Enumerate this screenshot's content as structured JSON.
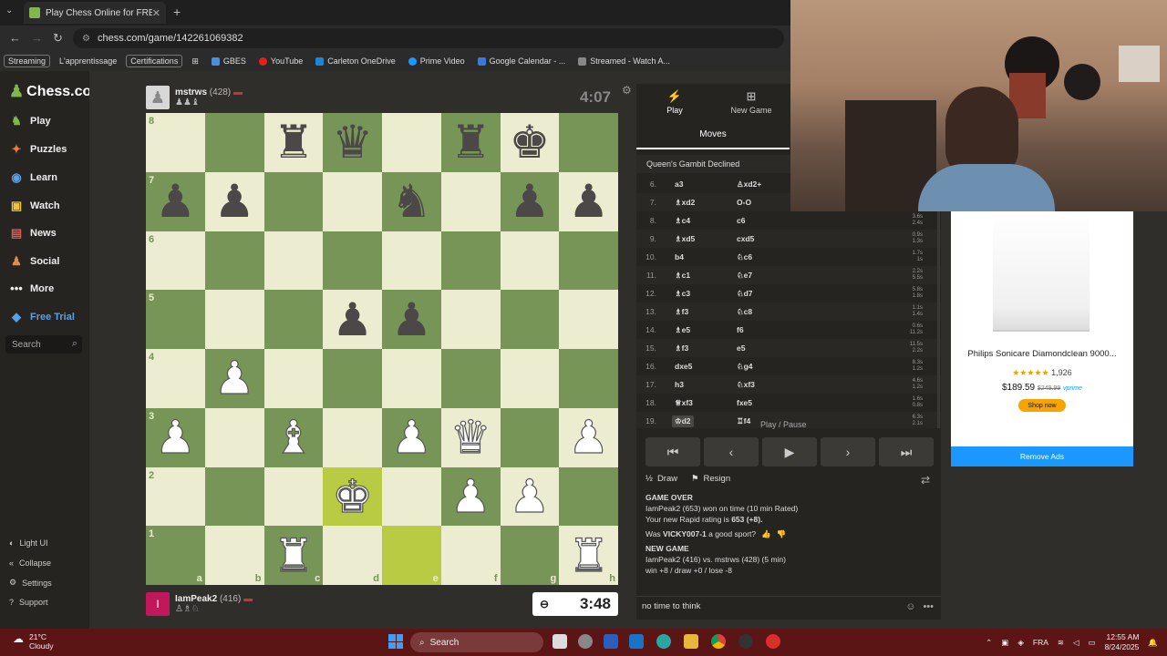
{
  "browser": {
    "tab_title": "Play Chess Online for FREE - 2 P",
    "url_site": "chess.com",
    "url_path": "chess.com/game/142261069382",
    "bookmarks": [
      "Streaming",
      "L'apprentissage",
      "Certifications",
      "GBES",
      "YouTube",
      "Carleton OneDrive",
      "Prime Video",
      "Google Calendar - ...",
      "Streamed - Watch A..."
    ]
  },
  "sidebar": {
    "logo": "Chess.com",
    "badge": "1",
    "items": [
      "Play",
      "Puzzles",
      "Learn",
      "Watch",
      "News",
      "Social",
      "More",
      "Free Trial"
    ],
    "search_placeholder": "Search",
    "bottom": [
      "Light UI",
      "Collapse",
      "Settings",
      "Support"
    ]
  },
  "top_player": {
    "name": "mstrws",
    "rating": "(428)",
    "captures": "♟♟♝",
    "clock": "4:07"
  },
  "bottom_player": {
    "name": "IamPeak2",
    "rating": "(416)",
    "captures": "♙♗♘",
    "clock": "3:48"
  },
  "board": {
    "light_color": "#ebecd0",
    "dark_color": "#779556",
    "highlight_squares": [
      "d2",
      "e1"
    ],
    "ranks": [
      "8",
      "7",
      "6",
      "5",
      "4",
      "3",
      "2",
      "1"
    ],
    "files": [
      "a",
      "b",
      "c",
      "d",
      "e",
      "f",
      "g",
      "h"
    ],
    "position": [
      [
        "",
        "",
        "bR",
        "bQ",
        "",
        "bR",
        "bK",
        ""
      ],
      [
        "bP",
        "bP",
        "",
        "",
        "bN",
        "",
        "bP",
        "bP"
      ],
      [
        "",
        "",
        "",
        "",
        "",
        "",
        "",
        ""
      ],
      [
        "",
        "",
        "",
        "bP",
        "bP",
        "",
        "",
        ""
      ],
      [
        "",
        "wP",
        "",
        "",
        "",
        "",
        "",
        ""
      ],
      [
        "wP",
        "",
        "wB",
        "",
        "wP",
        "wQ",
        "",
        "wP"
      ],
      [
        "",
        "",
        "",
        "wK",
        "",
        "wP",
        "wP",
        ""
      ],
      [
        "",
        "",
        "wR",
        "",
        "",
        "",
        "",
        "wR"
      ]
    ]
  },
  "panel": {
    "tabs": [
      {
        "label": "Play",
        "icon": "bolt-icon"
      },
      {
        "label": "New Game",
        "icon": "plus-icon"
      }
    ],
    "moves_tab": "Moves",
    "opening": "Queen's Gambit Declined",
    "moves": [
      {
        "n": "6.",
        "w": "a3",
        "b": "♙xd2+",
        "tw": "",
        "tb": ""
      },
      {
        "n": "7.",
        "w": "♗xd2",
        "b": "O-O",
        "tw": "",
        "tb": ""
      },
      {
        "n": "8.",
        "w": "♗c4",
        "b": "c6",
        "tw": "3.6s",
        "tb": "2.4s"
      },
      {
        "n": "9.",
        "w": "♗xd5",
        "b": "cxd5",
        "tw": "0.9s",
        "tb": "1.3s"
      },
      {
        "n": "10.",
        "w": "b4",
        "b": "♘c6",
        "tw": "1.7s",
        "tb": "1s"
      },
      {
        "n": "11.",
        "w": "♗c1",
        "b": "♘e7",
        "tw": "2.2s",
        "tb": "5.5s"
      },
      {
        "n": "12.",
        "w": "♗c3",
        "b": "♘d7",
        "tw": "5.8s",
        "tb": "1.8s"
      },
      {
        "n": "13.",
        "w": "♗f3",
        "b": "♘c8",
        "tw": "1.1s",
        "tb": "1.4s"
      },
      {
        "n": "14.",
        "w": "♗e5",
        "b": "f6",
        "tw": "0.6s",
        "tb": "11.2s"
      },
      {
        "n": "15.",
        "w": "♗f3",
        "b": "e5",
        "tw": "11.5s",
        "tb": "2.2s"
      },
      {
        "n": "16.",
        "w": "dxe5",
        "b": "♘g4",
        "tw": "8.3s",
        "tb": "1.2s"
      },
      {
        "n": "17.",
        "w": "h3",
        "b": "♘xf3",
        "tw": "4.6s",
        "tb": "1.2s"
      },
      {
        "n": "18.",
        "w": "♕xf3",
        "b": "fxe5",
        "tw": "1.6s",
        "tb": "0.8s"
      },
      {
        "n": "19.",
        "w": "♔d2",
        "b": "♖f4",
        "tw": "6.3s",
        "tb": "2.1s"
      }
    ],
    "tooltip": "Play / Pause",
    "draw": "Draw",
    "resign": "Resign",
    "log": {
      "game_over": "GAME OVER",
      "result": "IamPeak2 (653) won on time (10 min Rated)",
      "rating_prefix": "Your new Rapid rating is ",
      "rating_value": "653 (+8).",
      "sport_prefix": "Was ",
      "sport_user": "VICKY007-1",
      "sport_suffix": " a good sport?",
      "new_game": "NEW GAME",
      "matchup": "IamPeak2 (416) vs. mstrws (428) (5 min)",
      "record": "win +8 / draw +0 / lose -8"
    },
    "chat_text": "no time to think"
  },
  "ad": {
    "title": "Philips Sonicare Diamondclean 9000...",
    "stars": "★★★★★",
    "reviews": "1,926",
    "price": "$189.59",
    "old_price": "$249.99",
    "prime": "vprime",
    "shop": "Shop now",
    "remove": "Remove Ads"
  },
  "taskbar": {
    "temp": "21°C",
    "weather": "Cloudy",
    "search": "Search",
    "lang": "FRA",
    "time": "12:55 AM",
    "date": "8/24/2025"
  }
}
